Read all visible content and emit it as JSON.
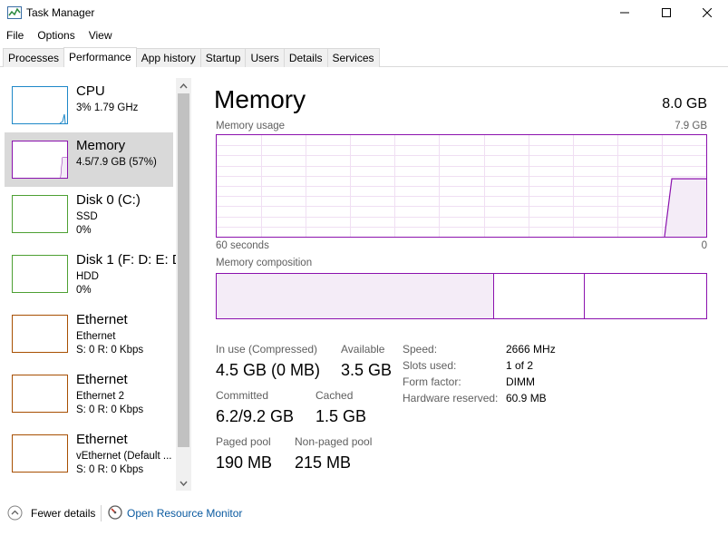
{
  "window": {
    "title": "Task Manager",
    "icon": "task-manager-icon"
  },
  "menu": [
    "File",
    "Options",
    "View"
  ],
  "tabs": [
    "Processes",
    "Performance",
    "App history",
    "Startup",
    "Users",
    "Details",
    "Services"
  ],
  "active_tab": "Performance",
  "sidebar": {
    "items": [
      {
        "title": "CPU",
        "lines": [
          "3%  1.79 GHz"
        ],
        "color": "#1e88c8"
      },
      {
        "title": "Memory",
        "lines": [
          "4.5/7.9 GB (57%)"
        ],
        "color": "#8b12ae",
        "selected": true
      },
      {
        "title": "Disk 0 (C:)",
        "lines": [
          "SSD",
          "0%"
        ],
        "color": "#4da033"
      },
      {
        "title": "Disk 1 (F: D: E: D",
        "lines": [
          "HDD",
          "0%"
        ],
        "color": "#4da033"
      },
      {
        "title": "Ethernet",
        "lines": [
          "Ethernet",
          "S: 0  R: 0 Kbps"
        ],
        "color": "#a74f01"
      },
      {
        "title": "Ethernet",
        "lines": [
          "Ethernet 2",
          "S: 0  R: 0 Kbps"
        ],
        "color": "#a74f01"
      },
      {
        "title": "Ethernet",
        "lines": [
          "vEthernet (Default ...",
          "S: 0  R: 0 Kbps"
        ],
        "color": "#a74f01"
      }
    ]
  },
  "main": {
    "title": "Memory",
    "total": "8.0 GB",
    "usage_label": "Memory usage",
    "usage_max": "7.9 GB",
    "time_left": "60 seconds",
    "time_right": "0",
    "composition_label": "Memory composition",
    "accent_color": "#8b12ae",
    "usage_level_fraction": 0.57,
    "stats": {
      "in_use_label": "In use (Compressed)",
      "in_use_value": "4.5 GB (0 MB)",
      "available_label": "Available",
      "available_value": "3.5 GB",
      "committed_label": "Committed",
      "committed_value": "6.2/9.2 GB",
      "cached_label": "Cached",
      "cached_value": "1.5 GB",
      "paged_label": "Paged pool",
      "paged_value": "190 MB",
      "nonpaged_label": "Non-paged pool",
      "nonpaged_value": "215 MB"
    },
    "details": {
      "speed_label": "Speed:",
      "speed_value": "2666 MHz",
      "slots_label": "Slots used:",
      "slots_value": "1 of 2",
      "form_label": "Form factor:",
      "form_value": "DIMM",
      "reserved_label": "Hardware reserved:",
      "reserved_value": "60.9 MB"
    }
  },
  "footer": {
    "fewer_details": "Fewer details",
    "open_resource_monitor": "Open Resource Monitor"
  }
}
